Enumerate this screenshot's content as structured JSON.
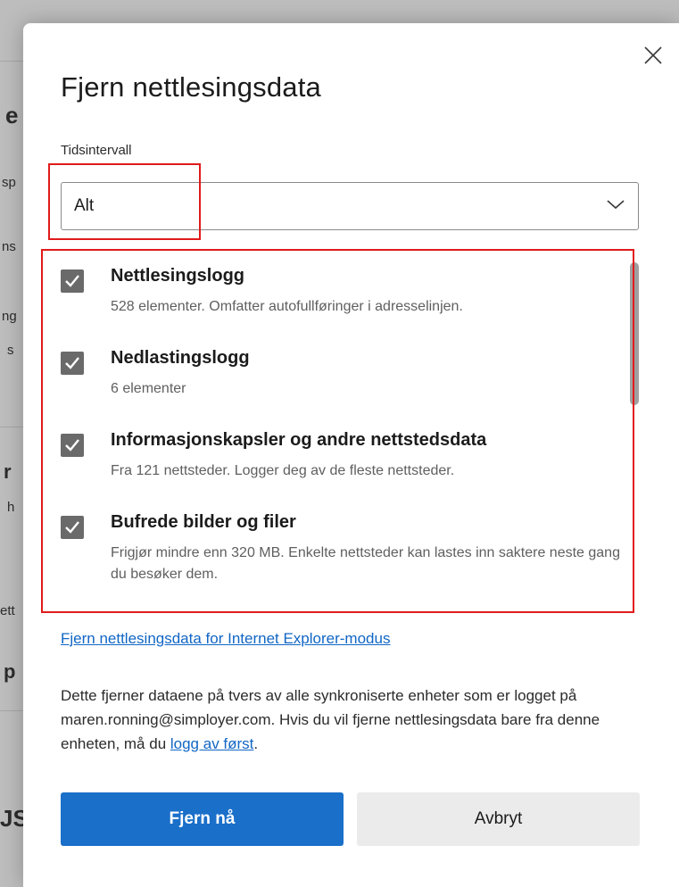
{
  "background": {
    "fragments": [
      "e",
      "sp",
      "ns",
      "ng",
      "s",
      "r",
      "h",
      "ett",
      "p",
      "JS"
    ]
  },
  "dialog": {
    "title": "Fjern nettlesingsdata",
    "close_icon": "close-icon",
    "time_range": {
      "label": "Tidsintervall",
      "selected": "Alt"
    },
    "items": [
      {
        "title": "Nettlesingslogg",
        "description": "528 elementer. Omfatter autofullføringer i adresselinjen.",
        "checked": true
      },
      {
        "title": "Nedlastingslogg",
        "description": "6 elementer",
        "checked": true
      },
      {
        "title": "Informasjonskapsler og andre nettstedsdata",
        "description": "Fra 121 nettsteder. Logger deg av de fleste nettsteder.",
        "checked": true
      },
      {
        "title": "Bufrede bilder og filer",
        "description": "Frigjør mindre enn 320 MB. Enkelte nettsteder kan lastes inn saktere neste gang du besøker dem.",
        "checked": true
      }
    ],
    "ie_link": "Fjern nettlesingsdata for Internet Explorer-modus",
    "sync_text": "Dette fjerner dataene på tvers av alle synkroniserte enheter som er logget på maren.ronning@simployer.com. Hvis du vil fjerne nettlesingsdata bare fra denne enheten, må du ",
    "sync_link": "logg av først",
    "sync_text_end": ".",
    "buttons": {
      "clear": "Fjern nå",
      "cancel": "Avbryt"
    },
    "colors": {
      "accent": "#1a6fc9",
      "link": "#1166c5",
      "highlight": "#e01b1b",
      "checkbox": "#6a6a6a"
    }
  }
}
